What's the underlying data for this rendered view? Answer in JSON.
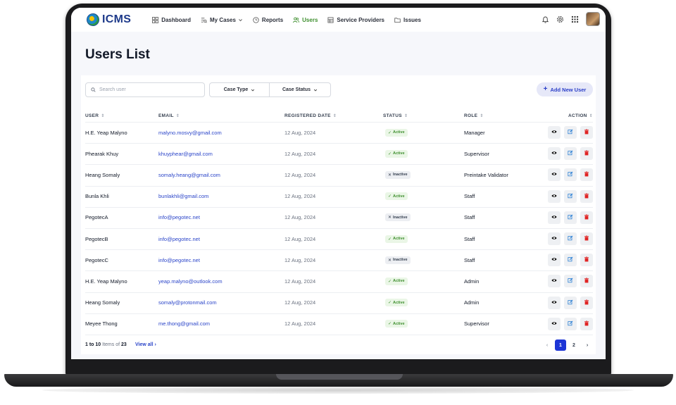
{
  "app": {
    "name": "ICMS"
  },
  "nav": {
    "items": [
      {
        "label": "Dashboard",
        "icon": "dashboard-icon"
      },
      {
        "label": "My Cases",
        "icon": "cases-icon"
      },
      {
        "label": "Reports",
        "icon": "reports-icon"
      },
      {
        "label": "Users",
        "icon": "users-icon",
        "active": true
      },
      {
        "label": "Service Providers",
        "icon": "providers-icon"
      },
      {
        "label": "Issues",
        "icon": "folder-icon"
      }
    ]
  },
  "page": {
    "title": "Users List"
  },
  "toolbar": {
    "search_placeholder": "Search user",
    "filter_case_type": "Case Type",
    "filter_case_status": "Case Status",
    "add_label": "Add New User"
  },
  "table": {
    "headers": {
      "user": "USER",
      "email": "EMAIL",
      "registered": "REGISTERED DATE",
      "status": "STATUS",
      "role": "ROLE",
      "action": "ACTION"
    },
    "rows": [
      {
        "user": "H.E. Yeap Malyno",
        "email": "malyno.mosvy@gmail.com",
        "date": "12 Aug, 2024",
        "status": "Active",
        "role": "Manager"
      },
      {
        "user": "Phearak Khuy",
        "email": "khuyphear@gmail.com",
        "date": "12 Aug, 2024",
        "status": "Active",
        "role": "Supervisor"
      },
      {
        "user": "Heang Somaly",
        "email": "somaly.heang@gmail.com",
        "date": "12 Aug, 2024",
        "status": "Inactive",
        "role": "Preintake Validator"
      },
      {
        "user": "Bunla Khli",
        "email": "bunlakhli@gmail.com",
        "date": "12 Aug, 2024",
        "status": "Active",
        "role": "Staff"
      },
      {
        "user": "PegotecA",
        "email": "info@pegotec.net",
        "date": "12 Aug, 2024",
        "status": "Inactive",
        "role": "Staff"
      },
      {
        "user": "PegotecB",
        "email": "info@pegotec.net",
        "date": "12 Aug, 2024",
        "status": "Active",
        "role": "Staff"
      },
      {
        "user": "PegotecC",
        "email": "info@pegotec.net",
        "date": "12 Aug, 2024",
        "status": "Inactive",
        "role": "Staff"
      },
      {
        "user": "H.E. Yeap Malyno",
        "email": "yeap.malyno@outlook.com",
        "date": "12 Aug, 2024",
        "status": "Active",
        "role": "Admin"
      },
      {
        "user": "Heang Somaly",
        "email": "somaly@protonmail.com",
        "date": "12 Aug, 2024",
        "status": "Active",
        "role": "Admin"
      },
      {
        "user": "Meyee Thong",
        "email": "me.thong@gmail.com",
        "date": "12 Aug, 2024",
        "status": "Active",
        "role": "Supervisor"
      }
    ]
  },
  "footer": {
    "range": "1 to 10",
    "items_of": "Items of",
    "total": "23",
    "view_all": "View all",
    "pages": [
      "1",
      "2"
    ],
    "current_page": "1"
  },
  "colors": {
    "primary": "#1d35d6",
    "active_green": "#3f8f2f",
    "link_blue": "#2b45c9",
    "delete_red": "#e02424",
    "edit_blue": "#2a7fd4"
  }
}
